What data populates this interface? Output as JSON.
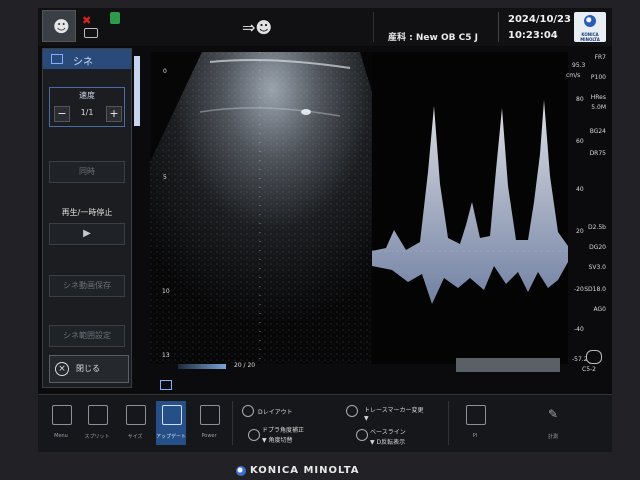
{
  "topbar": {
    "probe_preset": "産科 : New OB C5 J",
    "date": "2024/10/23",
    "time": "10:23:04",
    "brand_small": "KONICA MINOLTA",
    "icons": {
      "user": "user-add-icon",
      "tools": "tools-icon",
      "disk": "disk-icon",
      "database": "database-icon",
      "patient": "patient-transfer-icon"
    }
  },
  "cine_panel": {
    "title": "シネ",
    "speed_label": "速度",
    "speed_value": "1/1",
    "speed_minus": "−",
    "speed_plus": "+",
    "section_btn": "同時",
    "play_label": "再生/一時停止",
    "play_symbol": "▶",
    "save_btn": "シネ動画保存",
    "range_btn": "シネ範囲設定",
    "close_btn": "閉じる"
  },
  "bmode": {
    "depth_ticks": [
      "0",
      "5",
      "10",
      "13"
    ],
    "frame_counter": "20 / 20"
  },
  "doppler": {
    "unit": "cm/s",
    "max_label": "95.3",
    "min_label": "-57.2",
    "velocity_ticks": [
      "80",
      "60",
      "40",
      "20",
      "-20",
      "-40"
    ]
  },
  "params": {
    "fr": "FR7",
    "power": "P100",
    "hres": "HRes",
    "freq": "5.0M",
    "bg": "BG24",
    "dr": "DR75",
    "d": "D2.5b",
    "dg": "DG20",
    "sv": "SV3.0",
    "sd": "SD18.0",
    "ag": "AG0",
    "probe": "C5-2"
  },
  "bottombar": {
    "buttons": [
      {
        "label": "Menu",
        "icon": "menu-icon"
      },
      {
        "label": "スプリット",
        "icon": "split-icon"
      },
      {
        "label": "サイズ",
        "icon": "size-icon"
      },
      {
        "label": "アップデート",
        "icon": "update-icon"
      },
      {
        "label": "Power",
        "icon": "power-icon"
      }
    ],
    "knob_labels": {
      "d_layout": "Dレイアウト",
      "doppler_angle": "ドプラ角度補正",
      "angle_quick": "▼ 角度切替",
      "trace_marker": "トレースマーカー変更",
      "trace_sub": "▼",
      "baseline": "ベースライン",
      "d_invert": "▼ D反転表示"
    },
    "right_buttons": [
      {
        "label": "Pl",
        "icon": "grid-icon"
      },
      {
        "label": "計測",
        "icon": "pen-icon"
      }
    ]
  },
  "footer": {
    "brand": "KONICA MINOLTA"
  }
}
